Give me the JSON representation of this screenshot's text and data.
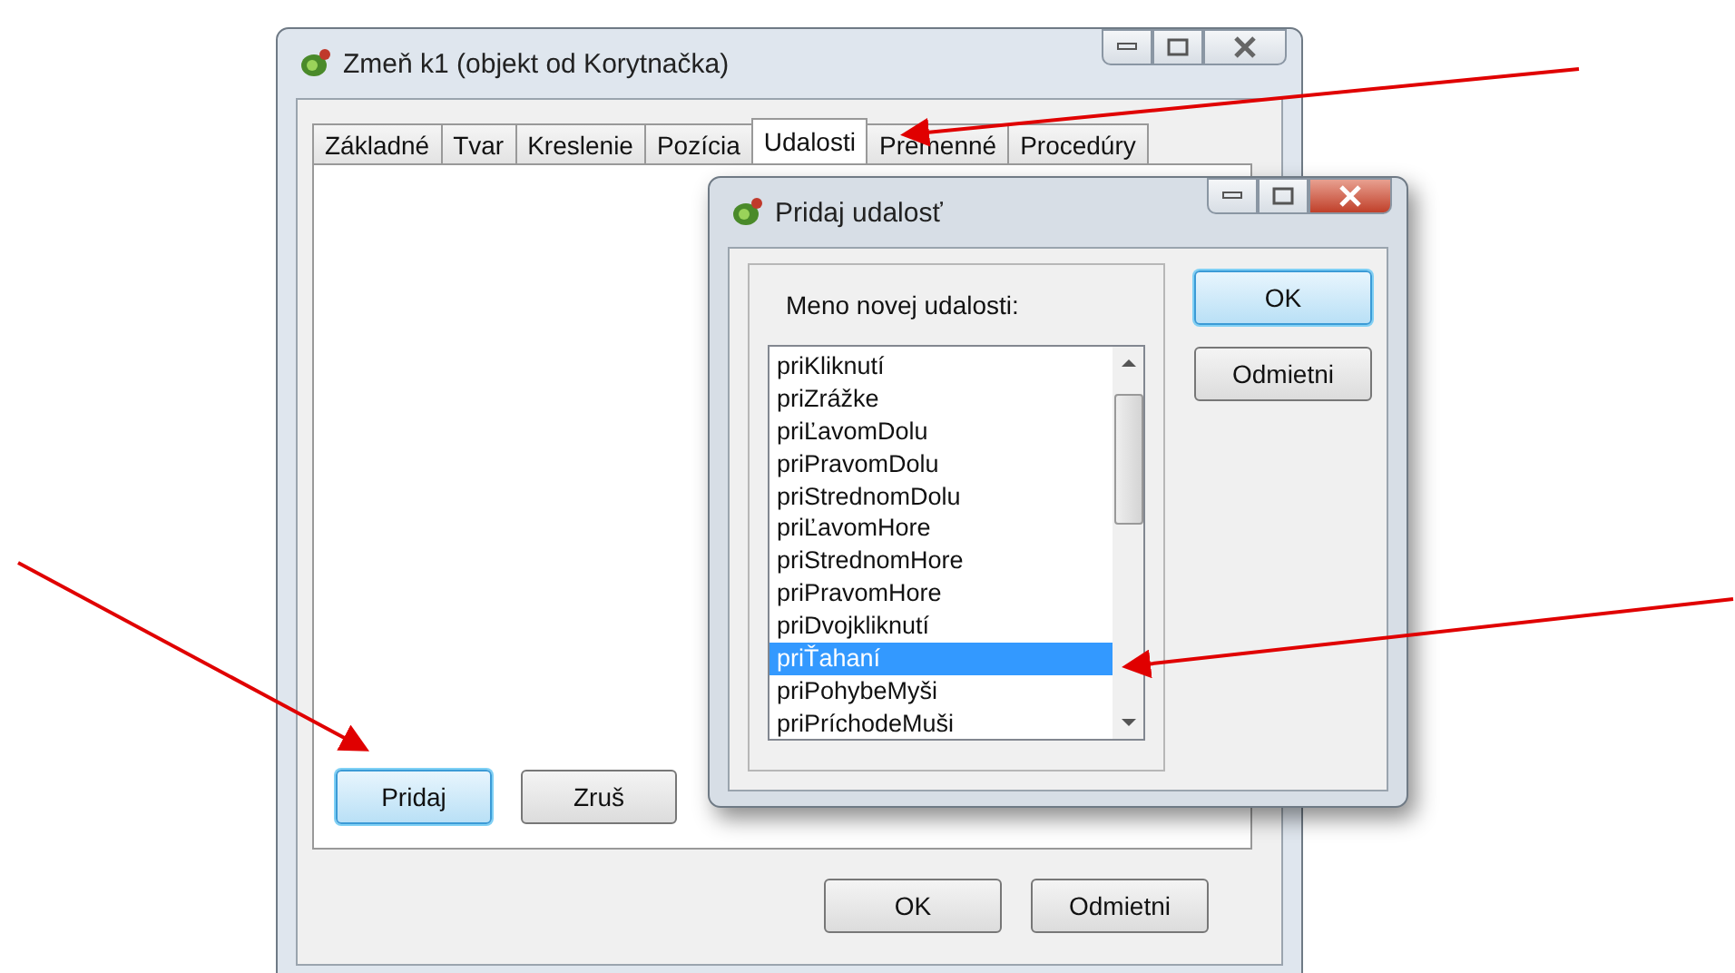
{
  "main_window": {
    "title": "Zmeň k1 (objekt od Korytnačka)",
    "tabs": [
      {
        "label": "Základné",
        "selected": false
      },
      {
        "label": "Tvar",
        "selected": false
      },
      {
        "label": "Kreslenie",
        "selected": false
      },
      {
        "label": "Pozícia",
        "selected": false
      },
      {
        "label": "Udalosti",
        "selected": true
      },
      {
        "label": "Premenné",
        "selected": false
      },
      {
        "label": "Procedúry",
        "selected": false
      }
    ],
    "panel_buttons": [
      {
        "label": "Pridaj",
        "focused": true
      },
      {
        "label": "Zruš",
        "focused": false
      }
    ],
    "buttons": [
      "OK",
      "Odmietni"
    ]
  },
  "dialog": {
    "title": "Pridaj udalosť",
    "label": "Meno novej udalosti:",
    "events": [
      {
        "label": "priKliknutí",
        "selected": false
      },
      {
        "label": "priZrážke",
        "selected": false
      },
      {
        "label": "priĽavomDolu",
        "selected": false
      },
      {
        "label": "priPravomDolu",
        "selected": false
      },
      {
        "label": "priStrednomDolu",
        "selected": false
      },
      {
        "label": "priĽavomHore",
        "selected": false
      },
      {
        "label": "priStrednomHore",
        "selected": false
      },
      {
        "label": "priPravomHore",
        "selected": false
      },
      {
        "label": "priDvojkliknutí",
        "selected": false
      },
      {
        "label": "priŤahaní",
        "selected": true
      },
      {
        "label": "priPohybeMyši",
        "selected": false
      },
      {
        "label": "priPríchodeMuši",
        "selected": false
      }
    ],
    "buttons": [
      {
        "label": "OK",
        "focused": true
      },
      {
        "label": "Odmietni",
        "focused": false
      }
    ]
  }
}
